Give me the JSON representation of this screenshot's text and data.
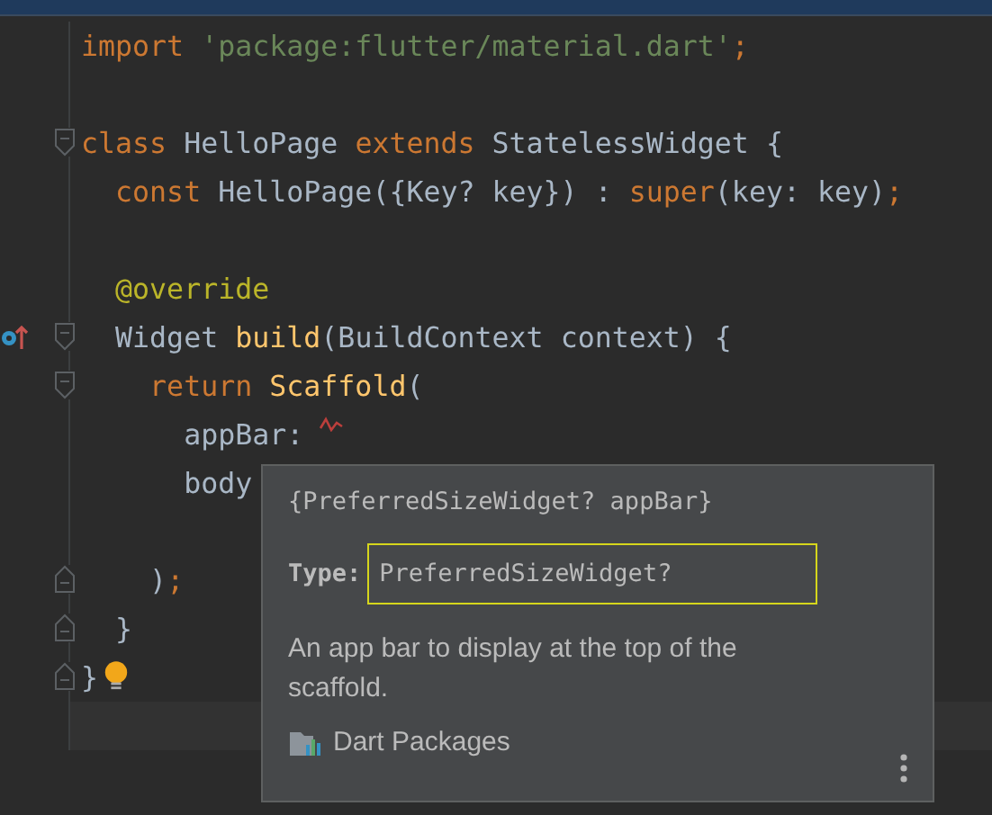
{
  "editor": {
    "lines": [
      {
        "kind": "code",
        "tokens": [
          {
            "kind": "keyword",
            "text": "import "
          },
          {
            "kind": "string",
            "text": "'package:flutter/material.dart'"
          },
          {
            "kind": "keyword",
            "text": ";"
          }
        ]
      },
      {
        "kind": "blank"
      },
      {
        "kind": "code",
        "fold_start": true,
        "tokens": [
          {
            "kind": "keyword",
            "text": "class "
          },
          {
            "kind": "plain",
            "text": "HelloPage "
          },
          {
            "kind": "keyword",
            "text": "extends "
          },
          {
            "kind": "plain",
            "text": "StatelessWidget {"
          }
        ]
      },
      {
        "kind": "code",
        "tokens": [
          {
            "kind": "keyword",
            "text": "  const "
          },
          {
            "kind": "plain",
            "text": "HelloPage({Key? key}) : "
          },
          {
            "kind": "keyword",
            "text": "super"
          },
          {
            "kind": "plain",
            "text": "(key: key)"
          },
          {
            "kind": "keyword",
            "text": ";"
          }
        ]
      },
      {
        "kind": "blank"
      },
      {
        "kind": "code",
        "tokens": [
          {
            "kind": "annotation",
            "text": "  @override"
          }
        ]
      },
      {
        "kind": "code",
        "fold_start": true,
        "override": true,
        "tokens": [
          {
            "kind": "plain",
            "text": "  Widget "
          },
          {
            "kind": "function",
            "text": "build"
          },
          {
            "kind": "plain",
            "text": "(BuildContext context) {"
          }
        ]
      },
      {
        "kind": "code",
        "fold_start": true,
        "tokens": [
          {
            "kind": "keyword",
            "text": "    return "
          },
          {
            "kind": "function",
            "text": "Scaffold"
          },
          {
            "kind": "plain",
            "text": "("
          }
        ]
      },
      {
        "kind": "code",
        "error": true,
        "tokens": [
          {
            "kind": "plain",
            "text": "      appBar:"
          }
        ]
      },
      {
        "kind": "code",
        "tokens": [
          {
            "kind": "plain",
            "text": "      body"
          }
        ]
      },
      {
        "kind": "blank"
      },
      {
        "kind": "code",
        "fold_end": true,
        "tokens": [
          {
            "kind": "plain",
            "text": "    )"
          },
          {
            "kind": "keyword",
            "text": ";"
          }
        ]
      },
      {
        "kind": "code",
        "fold_end": true,
        "tokens": [
          {
            "kind": "plain",
            "text": "  }"
          }
        ]
      },
      {
        "kind": "code",
        "fold_end": true,
        "bulb": true,
        "tokens": [
          {
            "kind": "plain",
            "text": "}"
          }
        ]
      },
      {
        "kind": "blank",
        "current": true
      }
    ]
  },
  "popup": {
    "signature": "{PreferredSizeWidget? appBar}",
    "type_label": "Type:",
    "type_value": "PreferredSizeWidget?",
    "description": "An app bar to display at the top of the scaffold.",
    "source": "Dart Packages"
  }
}
